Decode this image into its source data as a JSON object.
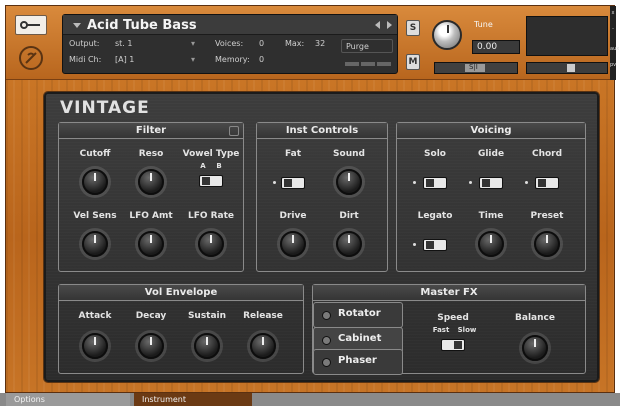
{
  "header": {
    "instrument_name": "Acid Tube Bass",
    "output_label": "Output:",
    "output_value": "st. 1",
    "midi_label": "Midi Ch:",
    "midi_value": "[A] 1",
    "voices_label": "Voices:",
    "voices_value": "0",
    "max_label": "Max:",
    "max_value": "32",
    "memory_label": "Memory:",
    "memory_value": "0",
    "purge_label": "Purge",
    "solo_label": "S",
    "mute_label": "M",
    "tune_label": "Tune",
    "tune_value": "0.00",
    "pan_label": "S|I",
    "side_labels": [
      "x",
      "-",
      "aux",
      "pv"
    ]
  },
  "panel": {
    "title": "VINTAGE",
    "filter": {
      "title": "Filter",
      "labels": [
        "Cutoff",
        "Reso",
        "Vowel Type",
        "Vel Sens",
        "LFO Amt",
        "LFO Rate"
      ],
      "vowel_options": [
        "A",
        "B"
      ]
    },
    "inst_controls": {
      "title": "Inst Controls",
      "labels": [
        "Fat",
        "Sound",
        "Drive",
        "Dirt"
      ]
    },
    "voicing": {
      "title": "Voicing",
      "labels": [
        "Solo",
        "Glide",
        "Chord",
        "Legato",
        "Time",
        "Preset"
      ]
    },
    "vol_envelope": {
      "title": "Vol Envelope",
      "labels": [
        "Attack",
        "Decay",
        "Sustain",
        "Release"
      ]
    },
    "master_fx": {
      "title": "Master FX",
      "tabs": [
        "Rotator",
        "Cabinet",
        "Phaser"
      ],
      "speed_label": "Speed",
      "speed_options": [
        "Fast",
        "Slow"
      ],
      "balance_label": "Balance"
    }
  },
  "bottom_tabs": [
    "Options",
    "Instrument"
  ]
}
